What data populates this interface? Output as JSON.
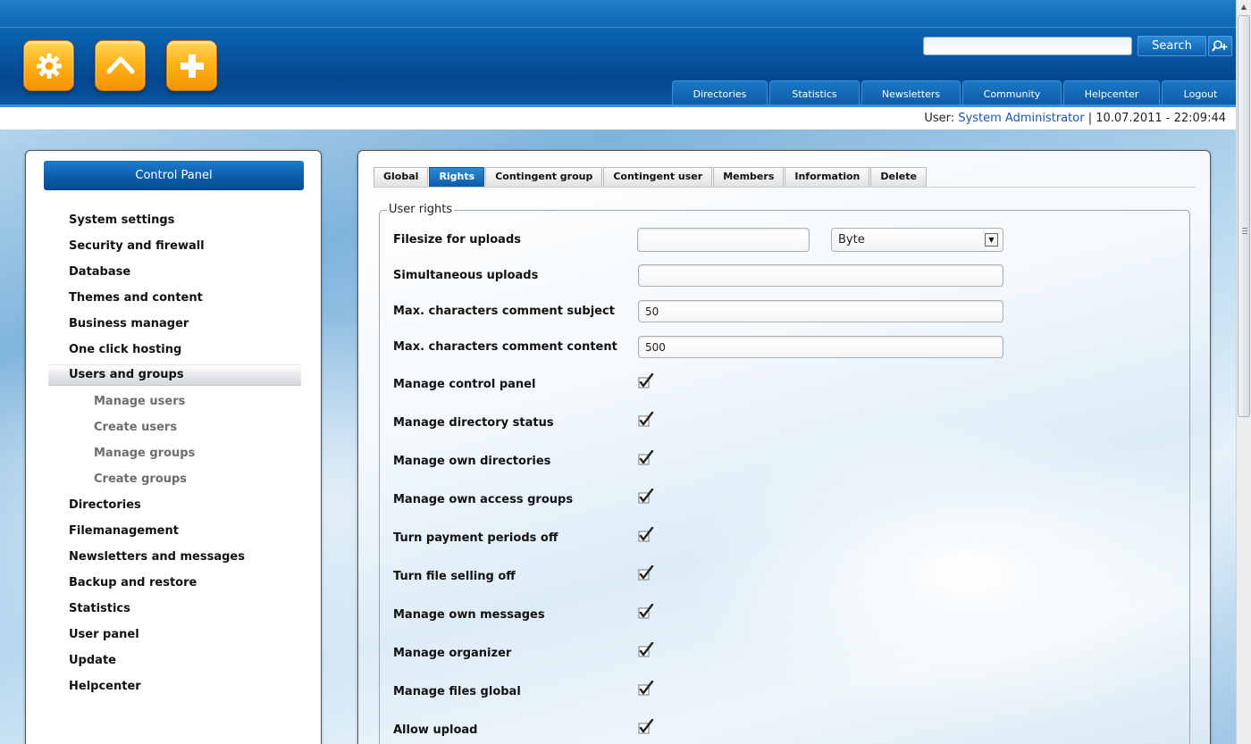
{
  "header": {
    "app_icons": [
      {
        "name": "settings-gear-icon"
      },
      {
        "name": "home-up-icon"
      },
      {
        "name": "add-plus-icon"
      }
    ],
    "search": {
      "placeholder": "",
      "value": "",
      "button_label": "Search",
      "advanced_icon": "search-user-icon"
    },
    "nav": [
      "Directories",
      "Statistics",
      "Newsletters",
      "Community",
      "Helpcenter",
      "Logout"
    ]
  },
  "userbar": {
    "prefix": "User:",
    "username": "System Administrator",
    "separator": "|",
    "datetime": "10.07.2011 - 22:09:44"
  },
  "sidebar": {
    "title": "Control Panel",
    "items": [
      {
        "label": "System settings"
      },
      {
        "label": "Security and firewall"
      },
      {
        "label": "Database"
      },
      {
        "label": "Themes and content"
      },
      {
        "label": "Business manager"
      },
      {
        "label": "One click hosting"
      },
      {
        "label": "Users and groups",
        "active": true
      }
    ],
    "subitems": [
      "Manage users",
      "Create users",
      "Manage groups",
      "Create groups"
    ],
    "items_after": [
      "Directories",
      "Filemanagement",
      "Newsletters and messages",
      "Backup and restore",
      "Statistics",
      "User panel",
      "Update",
      "Helpcenter"
    ]
  },
  "main": {
    "tabs": [
      "Global",
      "Rights",
      "Contingent group",
      "Contingent user",
      "Members",
      "Information",
      "Delete"
    ],
    "active_tab": "Rights",
    "fieldset_legend": "User rights",
    "fields": {
      "filesize": {
        "label": "Filesize for uploads",
        "value": "",
        "unit": "Byte"
      },
      "simultaneous": {
        "label": "Simultaneous uploads",
        "value": ""
      },
      "max_subject": {
        "label": "Max. characters comment subject",
        "value": "50"
      },
      "max_content": {
        "label": "Max. characters comment content",
        "value": "500"
      }
    },
    "checkboxes": [
      {
        "label": "Manage control panel",
        "checked": true
      },
      {
        "label": "Manage directory status",
        "checked": true
      },
      {
        "label": "Manage own directories",
        "checked": true
      },
      {
        "label": "Manage own access groups",
        "checked": true
      },
      {
        "label": "Turn payment periods off",
        "checked": true
      },
      {
        "label": "Turn file selling off",
        "checked": true
      },
      {
        "label": "Manage own messages",
        "checked": true
      },
      {
        "label": "Manage organizer",
        "checked": true
      },
      {
        "label": "Manage files global",
        "checked": true
      },
      {
        "label": "Allow upload",
        "checked": true
      }
    ]
  },
  "colors": {
    "header_blue": "#0a63b0",
    "accent_blue": "#1b57a4",
    "icon_orange": "#ffb31b"
  }
}
